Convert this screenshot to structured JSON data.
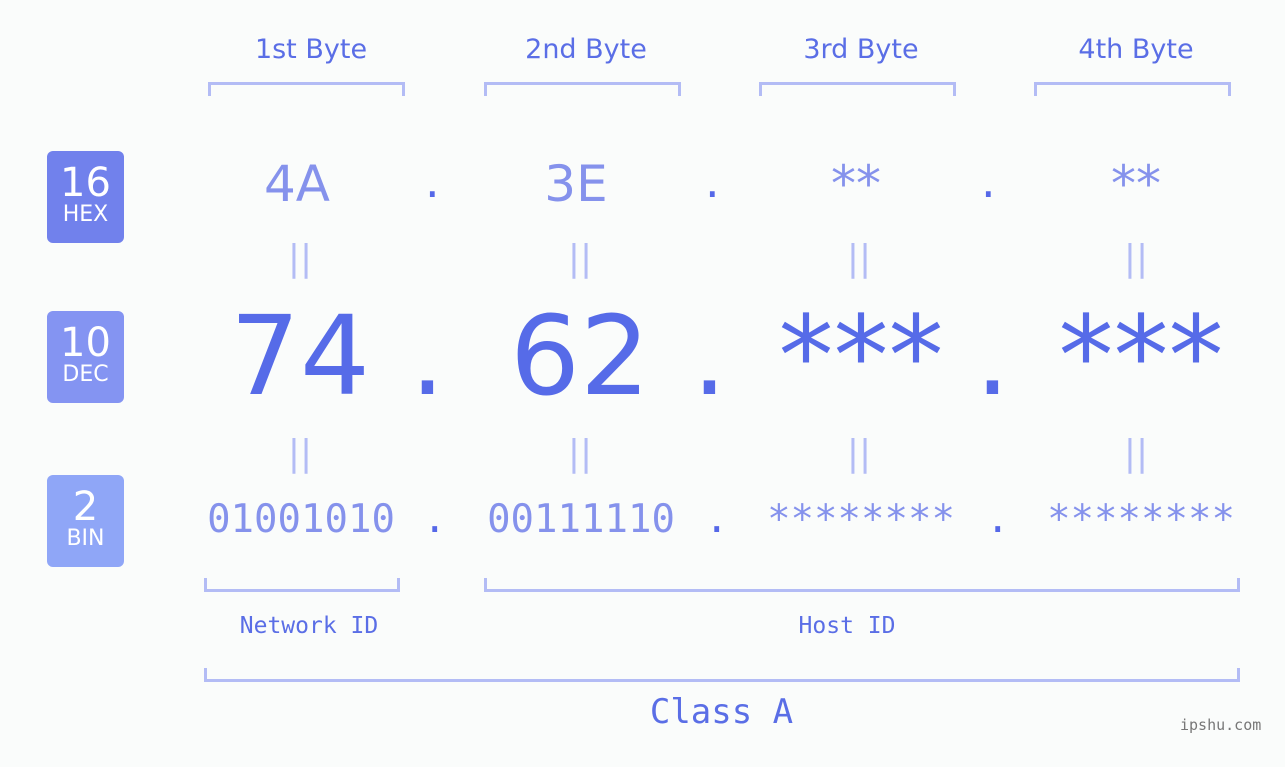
{
  "byte_headers": [
    "1st Byte",
    "2nd Byte",
    "3rd Byte",
    "4th Byte"
  ],
  "badges": [
    {
      "number": "16",
      "label": "HEX",
      "color": "#7181ec"
    },
    {
      "number": "10",
      "label": "DEC",
      "color": "#8494f2"
    },
    {
      "number": "2",
      "label": "BIN",
      "color": "#8fa6f7"
    }
  ],
  "hex": [
    "4A",
    "3E",
    "**",
    "**"
  ],
  "dec": [
    "74",
    "62",
    "***",
    "***"
  ],
  "bin": [
    "01001010",
    "00111110",
    "********",
    "********"
  ],
  "separator": ".",
  "equals_glyph": "||",
  "network_label": "Network ID",
  "host_label": "Host ID",
  "class_label": "Class A",
  "watermark": "ipshu.com",
  "colors": {
    "primary": "#566be8",
    "light": "#8592ec",
    "bracket": "#b3bcf5",
    "background": "#fafcfb"
  }
}
